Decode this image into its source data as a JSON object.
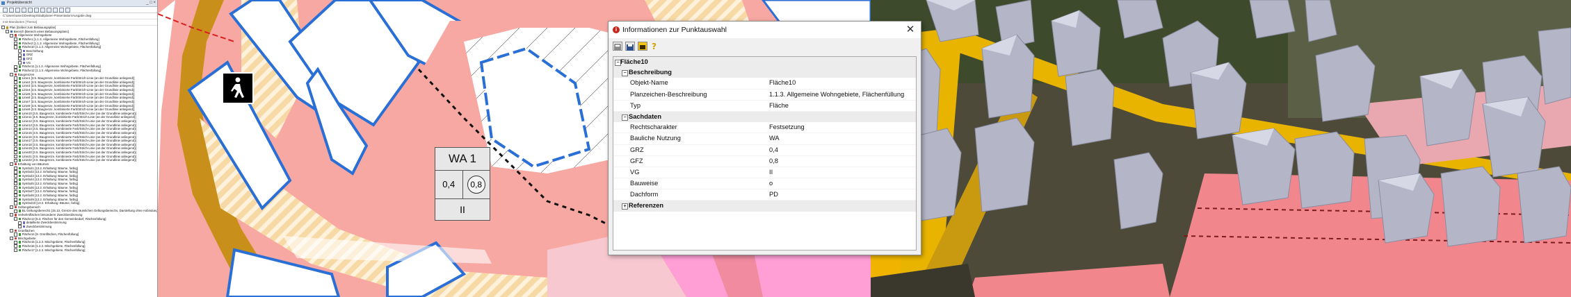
{
  "tree": {
    "title": "Projektübersicht",
    "window_buttons": "_ □ ×",
    "path": "C:\\Users\\user1\\Desktop\\Stadtplaner-Präsentation\\Ausgabe.dwg",
    "search": "Inst-Mandanten [Thema]",
    "rows": [
      {
        "depth": 0,
        "label": "Plan [Gebiet zum Bebauungsplan]"
      },
      {
        "depth": 1,
        "label": "Bereich [Bereich eines Bebauungsplans]"
      },
      {
        "depth": 2,
        "label": "Allgemeine Wohngebiete"
      },
      {
        "depth": 3,
        "label": "Fläche1 [1.1.3. Allgemeine Wohngebiete, Flächenfüllung]"
      },
      {
        "depth": 3,
        "label": "Fläche2 [1.1.3. Allgemeine Wohngebiete, Flächenfüllung]"
      },
      {
        "depth": 3,
        "label": "Fläche10 [1.1.3. Allgemeine Wohngebiete, Flächenfüllung]"
      },
      {
        "depth": 4,
        "label": "Beschriftung"
      },
      {
        "depth": 4,
        "label": "GRZ"
      },
      {
        "depth": 4,
        "label": "GFZ"
      },
      {
        "depth": 4,
        "label": "VG"
      },
      {
        "depth": 3,
        "label": "Fläche11 [1.1.3. Allgemeine Wohngebiete, Flächenfüllung]"
      },
      {
        "depth": 3,
        "label": "Fläche12 [1.1.3. Allgemeine Wohngebiete, Flächenfüllung]"
      },
      {
        "depth": 2,
        "label": "Baugrenzen"
      },
      {
        "depth": 3,
        "label": "Linie1 [3.5. Baugrenze, kombinierte Farb/Strich-Linie (an der Grundlinie anliegend)]"
      },
      {
        "depth": 3,
        "label": "Linie2 [3.5. Baugrenze, kombinierte Farb/Strich-Linie (an der Grundlinie anliegend)]"
      },
      {
        "depth": 3,
        "label": "Linie3 [3.5. Baugrenze, kombinierte Farb/Strich-Linie (an der Grundlinie anliegend)]"
      },
      {
        "depth": 3,
        "label": "Linie4 [3.5. Baugrenze, kombinierte Farb/Strich-Linie (an der Grundlinie anliegend)]"
      },
      {
        "depth": 3,
        "label": "Linie5 [3.5. Baugrenze, kombinierte Farb/Strich-Linie (an der Grundlinie anliegend)]"
      },
      {
        "depth": 3,
        "label": "Linie6 [3.5. Baugrenze, kombinierte Farb/Strich-Linie (an der Grundlinie anliegend)]"
      },
      {
        "depth": 3,
        "label": "Linie7 [3.5. Baugrenze, kombinierte Farb/Strich-Linie (an der Grundlinie anliegend)]"
      },
      {
        "depth": 3,
        "label": "Linie8 [3.5. Baugrenze, kombinierte Farb/Strich-Linie (an der Grundlinie anliegend)]"
      },
      {
        "depth": 3,
        "label": "Linie9 [3.5. Baugrenze, kombinierte Farb/Strich-Linie (an der Grundlinie anliegend)]"
      },
      {
        "depth": 3,
        "label": "Linie10 [3.5. Baugrenze, kombinierte Farb/Strich-Linie (an der Grundlinie anliegend)]"
      },
      {
        "depth": 3,
        "label": "Linie11 [3.5. Baugrenze, kombinierte Farb/Strich-Linie (an der Grundlinie anliegend)]"
      },
      {
        "depth": 3,
        "label": "Linie12 [3.5. Baugrenze, kombinierte Farb/Strich-Linie (an der Grundlinie anliegend)]"
      },
      {
        "depth": 3,
        "label": "Linie13 [3.5. Baugrenze, kombinierte Farb/Strich-Linie (an der Grundlinie anliegend)]"
      },
      {
        "depth": 3,
        "label": "Linie14 [3.5. Baugrenze, kombinierte Farb/Strich-Linie (an der Grundlinie anliegend)]"
      },
      {
        "depth": 3,
        "label": "Linie15 [3.5. Baugrenze, kombinierte Farb/Strich-Linie (an der Grundlinie anliegend)]"
      },
      {
        "depth": 3,
        "label": "Linie16 [3.5. Baugrenze, kombinierte Farb/Strich-Linie (an der Grundlinie anliegend)]"
      },
      {
        "depth": 3,
        "label": "Linie17 [3.5. Baugrenze, kombinierte Farb/Strich-Linie (an der Grundlinie anliegend)]"
      },
      {
        "depth": 3,
        "label": "Linie18 [3.5. Baugrenze, kombinierte Farb/Strich-Linie (an der Grundlinie anliegend)]"
      },
      {
        "depth": 3,
        "label": "Linie19 [3.5. Baugrenze, kombinierte Farb/Strich-Linie (an der Grundlinie anliegend)]"
      },
      {
        "depth": 3,
        "label": "Linie20 [3.5. Baugrenze, kombinierte Farb/Strich-Linie (an der Grundlinie anliegend)]"
      },
      {
        "depth": 3,
        "label": "Linie21 [3.5. Baugrenze, kombinierte Farb/Strich-Linie (an der Grundlinie anliegend)]"
      },
      {
        "depth": 3,
        "label": "Linie22 [3.5. Baugrenze, kombinierte Farb/Strich-Linie (an der Grundlinie anliegend)]"
      },
      {
        "depth": 2,
        "label": "Erhaltung von Bäumen"
      },
      {
        "depth": 3,
        "label": "Symbol1 [13.2. Erhaltung: Bäume, farbig]"
      },
      {
        "depth": 3,
        "label": "Symbol2 [13.2. Erhaltung: Bäume, farbig]"
      },
      {
        "depth": 3,
        "label": "Symbol3 [13.2. Erhaltung: Bäume, farbig]"
      },
      {
        "depth": 3,
        "label": "Symbol4 [13.2. Erhaltung: Bäume, farbig]"
      },
      {
        "depth": 3,
        "label": "Symbol5 [13.2. Erhaltung: Bäume, farbig]"
      },
      {
        "depth": 3,
        "label": "Symbol6 [13.2. Erhaltung: Bäume, farbig]"
      },
      {
        "depth": 3,
        "label": "Symbol7 [13.2. Erhaltung: Bäume, farbig]"
      },
      {
        "depth": 3,
        "label": "Symbol8 [13.2. Erhaltung: Bäume, farbig]"
      },
      {
        "depth": 3,
        "label": "Symbol9 [13.2. Erhaltung: Bäume, farbig]"
      },
      {
        "depth": 3,
        "label": "Symbol10 [13.2. Erhaltung: Bäume, farbig]"
      },
      {
        "depth": 2,
        "label": "Geltungsbereich"
      },
      {
        "depth": 3,
        "label": "BL Geltungsbereich1 [15.13. Grenze des räumlichen Geltungsbereichs, Darstellung ohne Anbindung]"
      },
      {
        "depth": 2,
        "label": "Verkehrsflächen besonderer Zweckbestimmung"
      },
      {
        "depth": 3,
        "label": "Fläche13 [6.3. Flächen für den Gemeinbedarf, Flächenfüllung]"
      },
      {
        "depth": 4,
        "label": "detaillierte Zweckbestimmung"
      },
      {
        "depth": 4,
        "label": "Zweckbestimmung"
      },
      {
        "depth": 2,
        "label": "Grünflächen"
      },
      {
        "depth": 3,
        "label": "Fläche14 [9. Grünflächen, Flächenfüllung]"
      },
      {
        "depth": 2,
        "label": "Mischgebiete"
      },
      {
        "depth": 3,
        "label": "Fläche15 [1.2.3. Mischgebiete, Flächenfüllung]"
      },
      {
        "depth": 3,
        "label": "Fläche16 [1.2.3. Mischgebiete, Flächenfüllung]"
      },
      {
        "depth": 3,
        "label": "Fläche17 [1.2.3. Mischgebiete, Flächenfüllung]"
      }
    ]
  },
  "map": {
    "wa_label": "WA 1",
    "grz": "0,4",
    "gfz": "0,8",
    "vg": "II",
    "colors": {
      "wohngebiet": "#f7aaa4",
      "verkehr": "#c8901a",
      "baugrenze": "#2a6fd6",
      "gruen": "#ff9fd6",
      "hatch": "#fbe3b6"
    }
  },
  "dialog": {
    "title": "Informationen zur Punktauswahl",
    "close": "✕",
    "toolbar": [
      "print-icon",
      "save-icon",
      "screen-icon",
      "help-icon"
    ],
    "root": "Fläche10",
    "sections": [
      {
        "name": "Beschreibung",
        "expanded": true,
        "symbol": "−",
        "items": [
          {
            "key": "Objekt-Name",
            "value": "Fläche10"
          },
          {
            "key": "Planzeichen-Beschreibung",
            "value": "1.1.3. Allgemeine Wohngebiete, Flächenfüllung"
          },
          {
            "key": "Typ",
            "value": "Fläche"
          }
        ]
      },
      {
        "name": "Sachdaten",
        "expanded": true,
        "symbol": "−",
        "items": [
          {
            "key": "Rechtscharakter",
            "value": "Festsetzung"
          },
          {
            "key": "Bauliche Nutzung",
            "value": "WA"
          },
          {
            "key": "GRZ",
            "value": "0,4"
          },
          {
            "key": "GFZ",
            "value": "0,8"
          },
          {
            "key": "VG",
            "value": "II"
          },
          {
            "key": "Bauweise",
            "value": "o"
          },
          {
            "key": "Dachform",
            "value": "PD"
          }
        ]
      },
      {
        "name": "Referenzen",
        "expanded": false,
        "symbol": "+",
        "items": []
      }
    ]
  }
}
